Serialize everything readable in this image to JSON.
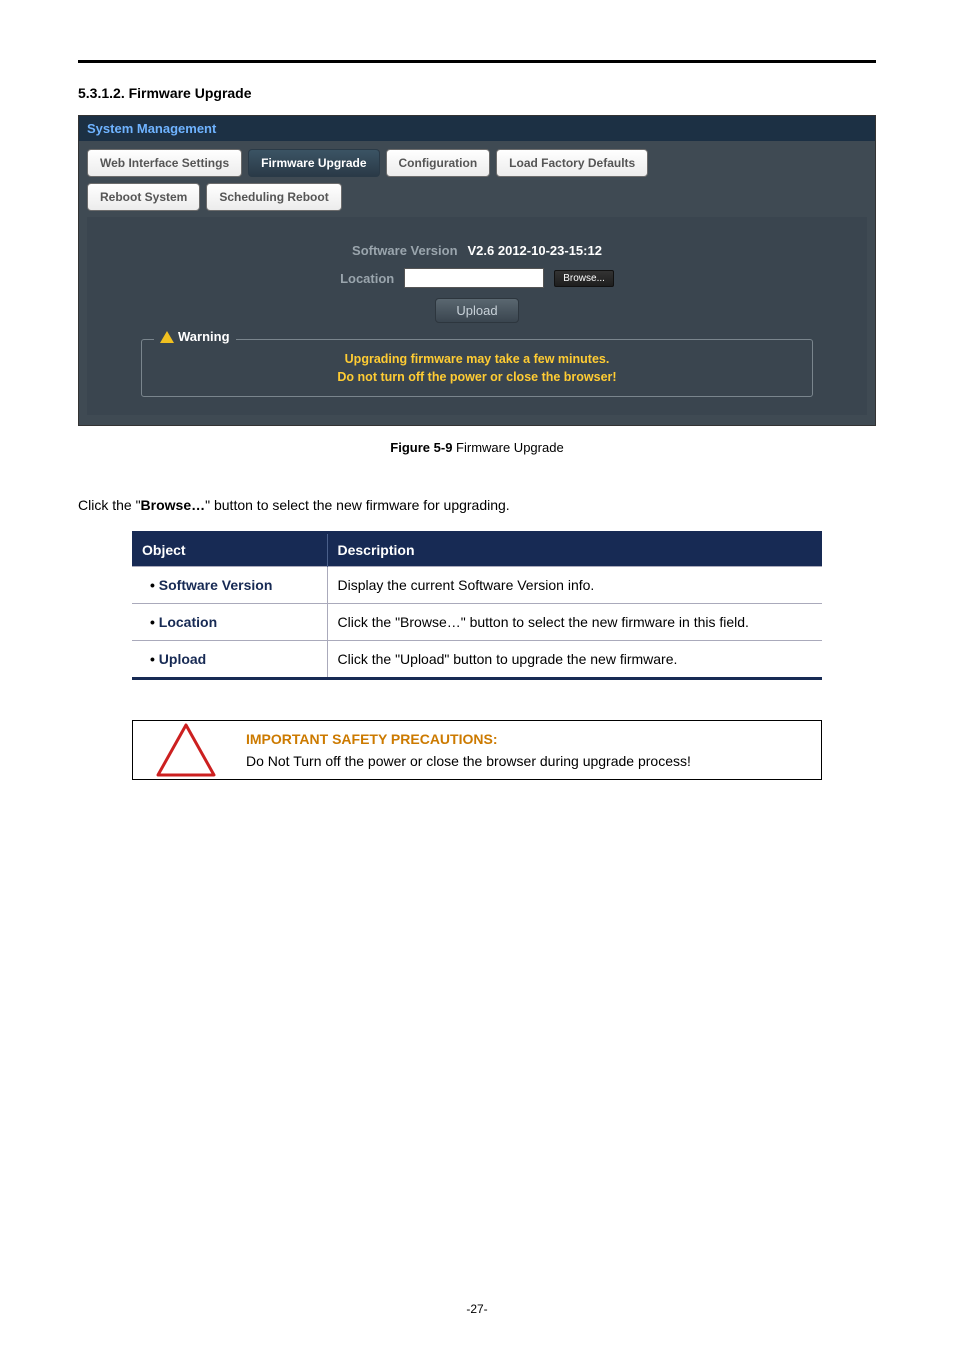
{
  "heading": {
    "number": "5.3.1.2.",
    "title": "Firmware Upgrade"
  },
  "panel": {
    "title": "System Management",
    "tabs": {
      "row1": [
        {
          "label": "Web Interface Settings",
          "active": false
        },
        {
          "label": "Firmware Upgrade",
          "active": true
        },
        {
          "label": "Configuration",
          "active": false
        },
        {
          "label": "Load Factory Defaults",
          "active": false
        }
      ],
      "row2": [
        {
          "label": "Reboot System",
          "active": false
        },
        {
          "label": "Scheduling Reboot",
          "active": false
        }
      ]
    },
    "fields": {
      "version_label": "Software Version",
      "version_value": "V2.6 2012-10-23-15:12",
      "location_label": "Location",
      "browse_label": "Browse...",
      "upload_label": "Upload"
    },
    "warning": {
      "legend": "Warning",
      "line1": "Upgrading firmware may take a few minutes.",
      "line2": "Do not turn off the power or close the browser!"
    }
  },
  "caption": {
    "fig": "Figure 5-9",
    "text": " Firmware Upgrade"
  },
  "instruction": {
    "pre": "Click the \"",
    "bold": "Browse…",
    "post": "\" button to select the new firmware for upgrading."
  },
  "table": {
    "headers": {
      "object": "Object",
      "description": "Description"
    },
    "rows": [
      {
        "obj": "Software Version",
        "desc": "Display the current Software Version info."
      },
      {
        "obj": "Location",
        "desc": "Click the \"Browse…\" button to select the new firmware in this field."
      },
      {
        "obj": "Upload",
        "desc": "Click the \"Upload\" button to upgrade the new firmware."
      }
    ]
  },
  "safety": {
    "header": "IMPORTANT SAFETY PRECAUTIONS:",
    "body": "Do Not Turn off the power or close the browser during upgrade process!"
  },
  "page_number": "-27-"
}
